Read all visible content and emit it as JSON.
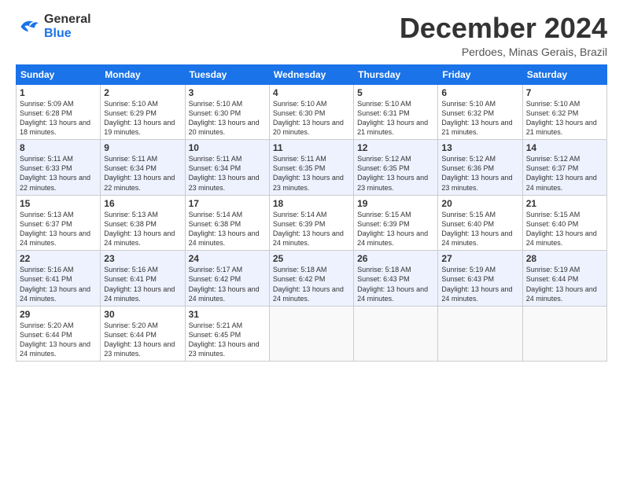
{
  "logo": {
    "line1": "General",
    "line2": "Blue"
  },
  "title": "December 2024",
  "subtitle": "Perdoes, Minas Gerais, Brazil",
  "headers": [
    "Sunday",
    "Monday",
    "Tuesday",
    "Wednesday",
    "Thursday",
    "Friday",
    "Saturday"
  ],
  "weeks": [
    [
      {
        "day": "1",
        "rise": "5:09 AM",
        "set": "6:28 PM",
        "daylight": "13 hours and 18 minutes."
      },
      {
        "day": "2",
        "rise": "5:10 AM",
        "set": "6:29 PM",
        "daylight": "13 hours and 19 minutes."
      },
      {
        "day": "3",
        "rise": "5:10 AM",
        "set": "6:30 PM",
        "daylight": "13 hours and 20 minutes."
      },
      {
        "day": "4",
        "rise": "5:10 AM",
        "set": "6:30 PM",
        "daylight": "13 hours and 20 minutes."
      },
      {
        "day": "5",
        "rise": "5:10 AM",
        "set": "6:31 PM",
        "daylight": "13 hours and 21 minutes."
      },
      {
        "day": "6",
        "rise": "5:10 AM",
        "set": "6:32 PM",
        "daylight": "13 hours and 21 minutes."
      },
      {
        "day": "7",
        "rise": "5:10 AM",
        "set": "6:32 PM",
        "daylight": "13 hours and 21 minutes."
      }
    ],
    [
      {
        "day": "8",
        "rise": "5:11 AM",
        "set": "6:33 PM",
        "daylight": "13 hours and 22 minutes."
      },
      {
        "day": "9",
        "rise": "5:11 AM",
        "set": "6:34 PM",
        "daylight": "13 hours and 22 minutes."
      },
      {
        "day": "10",
        "rise": "5:11 AM",
        "set": "6:34 PM",
        "daylight": "13 hours and 23 minutes."
      },
      {
        "day": "11",
        "rise": "5:11 AM",
        "set": "6:35 PM",
        "daylight": "13 hours and 23 minutes."
      },
      {
        "day": "12",
        "rise": "5:12 AM",
        "set": "6:35 PM",
        "daylight": "13 hours and 23 minutes."
      },
      {
        "day": "13",
        "rise": "5:12 AM",
        "set": "6:36 PM",
        "daylight": "13 hours and 23 minutes."
      },
      {
        "day": "14",
        "rise": "5:12 AM",
        "set": "6:37 PM",
        "daylight": "13 hours and 24 minutes."
      }
    ],
    [
      {
        "day": "15",
        "rise": "5:13 AM",
        "set": "6:37 PM",
        "daylight": "13 hours and 24 minutes."
      },
      {
        "day": "16",
        "rise": "5:13 AM",
        "set": "6:38 PM",
        "daylight": "13 hours and 24 minutes."
      },
      {
        "day": "17",
        "rise": "5:14 AM",
        "set": "6:38 PM",
        "daylight": "13 hours and 24 minutes."
      },
      {
        "day": "18",
        "rise": "5:14 AM",
        "set": "6:39 PM",
        "daylight": "13 hours and 24 minutes."
      },
      {
        "day": "19",
        "rise": "5:15 AM",
        "set": "6:39 PM",
        "daylight": "13 hours and 24 minutes."
      },
      {
        "day": "20",
        "rise": "5:15 AM",
        "set": "6:40 PM",
        "daylight": "13 hours and 24 minutes."
      },
      {
        "day": "21",
        "rise": "5:15 AM",
        "set": "6:40 PM",
        "daylight": "13 hours and 24 minutes."
      }
    ],
    [
      {
        "day": "22",
        "rise": "5:16 AM",
        "set": "6:41 PM",
        "daylight": "13 hours and 24 minutes."
      },
      {
        "day": "23",
        "rise": "5:16 AM",
        "set": "6:41 PM",
        "daylight": "13 hours and 24 minutes."
      },
      {
        "day": "24",
        "rise": "5:17 AM",
        "set": "6:42 PM",
        "daylight": "13 hours and 24 minutes."
      },
      {
        "day": "25",
        "rise": "5:18 AM",
        "set": "6:42 PM",
        "daylight": "13 hours and 24 minutes."
      },
      {
        "day": "26",
        "rise": "5:18 AM",
        "set": "6:43 PM",
        "daylight": "13 hours and 24 minutes."
      },
      {
        "day": "27",
        "rise": "5:19 AM",
        "set": "6:43 PM",
        "daylight": "13 hours and 24 minutes."
      },
      {
        "day": "28",
        "rise": "5:19 AM",
        "set": "6:44 PM",
        "daylight": "13 hours and 24 minutes."
      }
    ],
    [
      {
        "day": "29",
        "rise": "5:20 AM",
        "set": "6:44 PM",
        "daylight": "13 hours and 24 minutes."
      },
      {
        "day": "30",
        "rise": "5:20 AM",
        "set": "6:44 PM",
        "daylight": "13 hours and 23 minutes."
      },
      {
        "day": "31",
        "rise": "5:21 AM",
        "set": "6:45 PM",
        "daylight": "13 hours and 23 minutes."
      },
      null,
      null,
      null,
      null
    ]
  ]
}
